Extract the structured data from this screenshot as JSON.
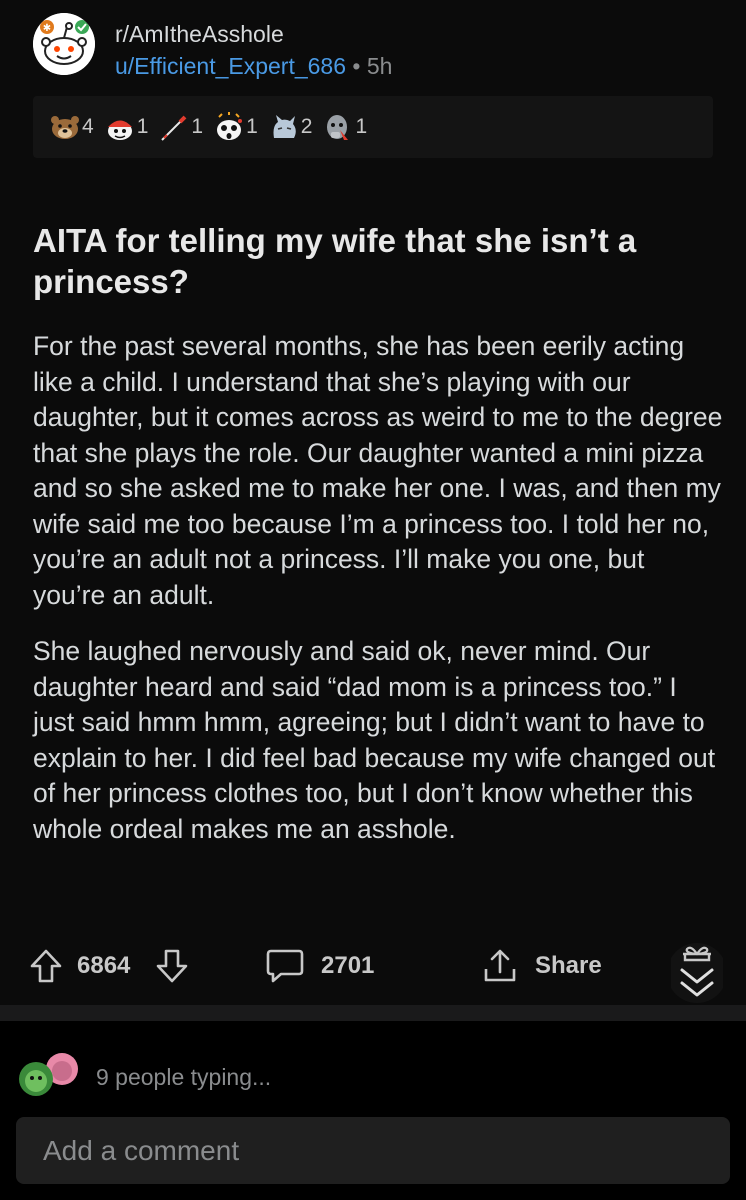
{
  "header": {
    "subreddit": "r/AmItheAsshole",
    "username": "u/Efficient_Expert_686",
    "separator": "•",
    "time": "5h"
  },
  "awards": [
    {
      "icon": "bear-award-icon",
      "count": "4"
    },
    {
      "icon": "snoo-helmet-award-icon",
      "count": "1"
    },
    {
      "icon": "pen-award-icon",
      "count": "1"
    },
    {
      "icon": "shocked-snoo-award-icon",
      "count": "1"
    },
    {
      "icon": "cat-award-icon",
      "count": "2"
    },
    {
      "icon": "facepalm-award-icon",
      "count": "1"
    }
  ],
  "post": {
    "title": "AITA for telling my wife that she isn’t a princess?",
    "paragraphs": [
      "For the past several months, she has been eerily acting like a child. I understand that she’s playing with our daughter, but it comes across as weird to me to the degree that she plays the role. Our daughter wanted a mini pizza and so she asked me to make her one. I was, and then my wife said me too because I’m a princess too. I told her no, you’re an adult not a princess. I’ll make you one, but you’re an adult.",
      "She laughed nervously and said ok, never mind. Our daughter heard and said “dad mom is a princess too.” I just said hmm hmm, agreeing; but I didn’t want to have to explain to her. I did feel bad because my wife changed out of her princess clothes too, but I don’t know whether this whole ordeal makes me an asshole."
    ]
  },
  "actions": {
    "votes": "6864",
    "comments": "2701",
    "share": "Share"
  },
  "typing": {
    "text": "9 people typing..."
  },
  "comment": {
    "placeholder": "Add a comment"
  },
  "colors": {
    "background": "#000000",
    "post_background": "#0b0b0b",
    "username": "#4a9ae5",
    "text": "#d7dadc",
    "muted": "#8a8c8e"
  }
}
